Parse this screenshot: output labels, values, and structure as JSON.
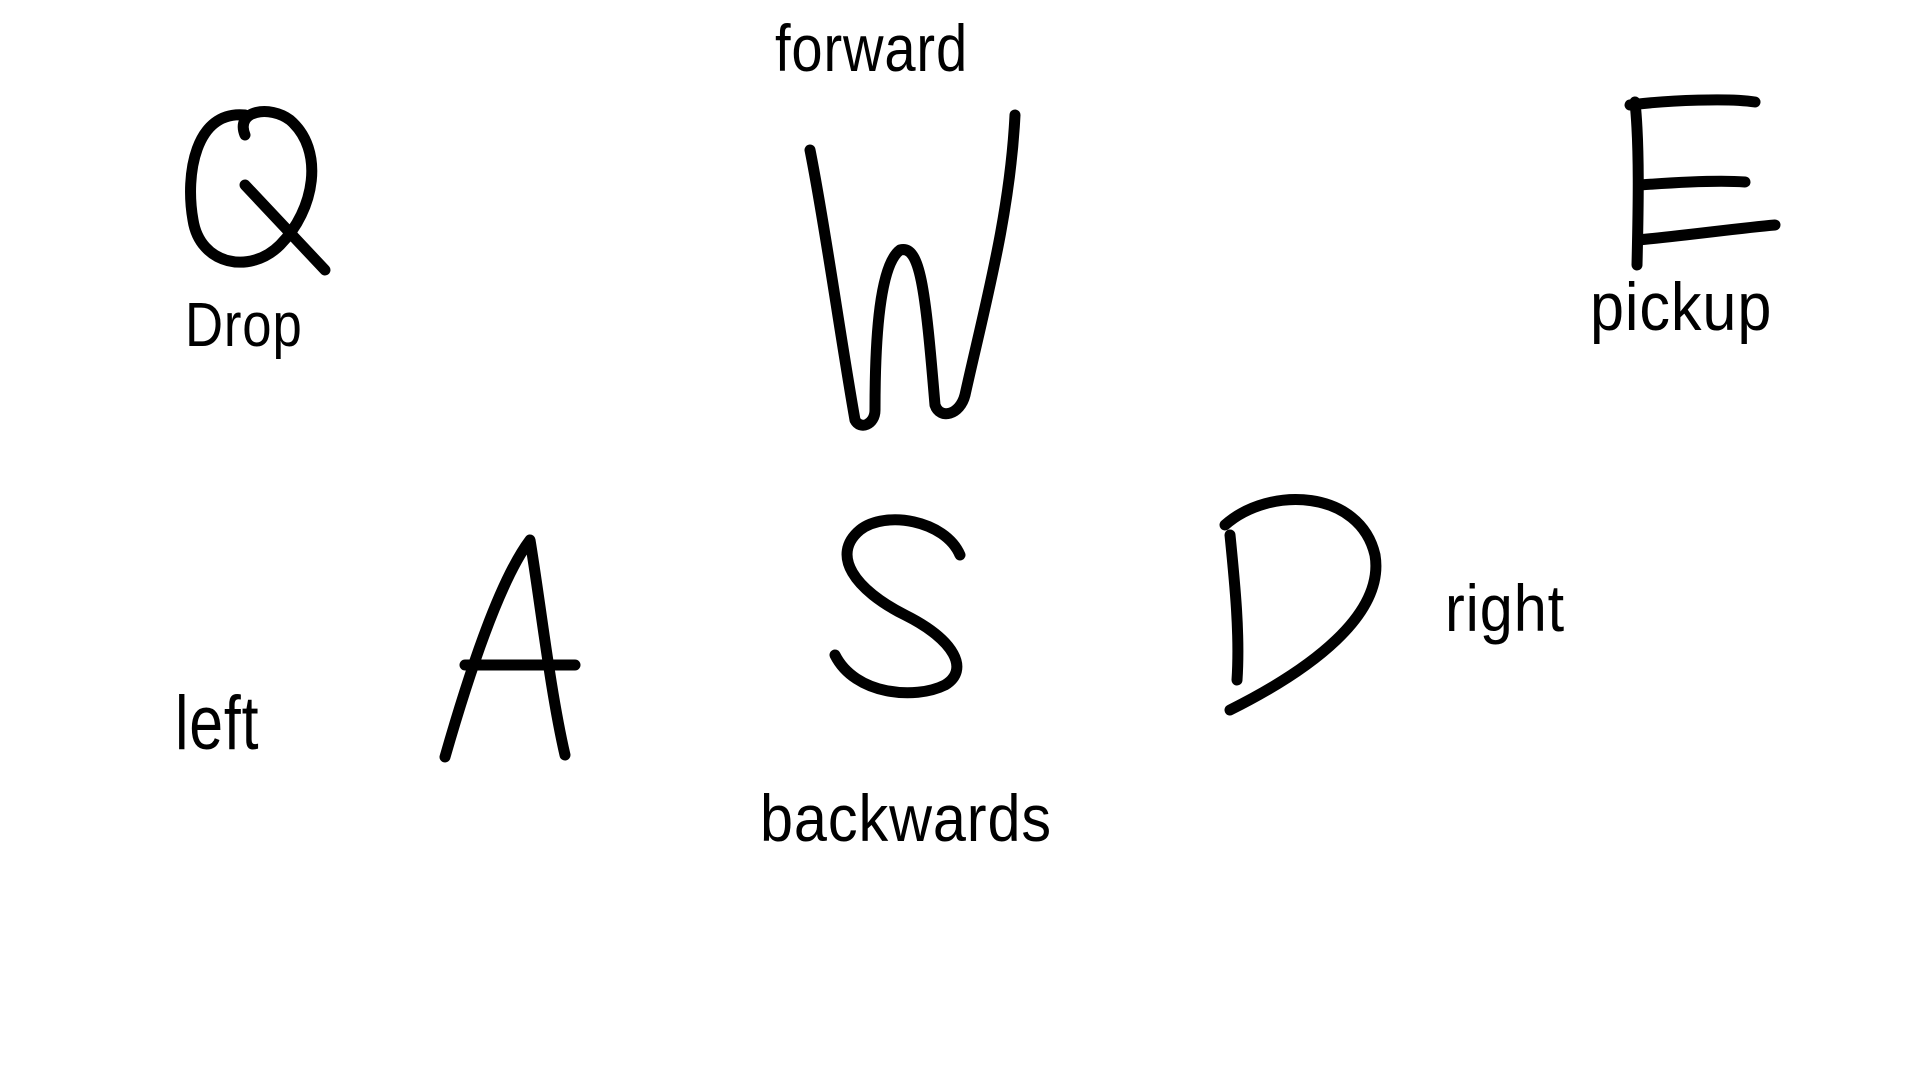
{
  "keys": {
    "q": {
      "letter": "Q",
      "action": "Drop"
    },
    "w": {
      "letter": "W",
      "action": "forward"
    },
    "e": {
      "letter": "E",
      "action": "pickup"
    },
    "a": {
      "letter": "A",
      "action": "left"
    },
    "s": {
      "letter": "S",
      "action": "backwards"
    },
    "d": {
      "letter": "D",
      "action": "right"
    }
  },
  "colors": {
    "ink": "#000000",
    "background": "#ffffff"
  }
}
